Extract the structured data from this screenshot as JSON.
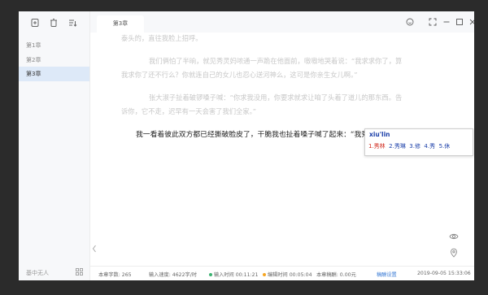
{
  "sidebar": {
    "chapters": [
      {
        "label": "第1章",
        "active": false
      },
      {
        "label": "第2章",
        "active": false
      },
      {
        "label": "第3章",
        "active": true
      }
    ],
    "bottom_label": "基中无人"
  },
  "tabs": [
    {
      "label": "第3章"
    }
  ],
  "editor": {
    "paragraphs": [
      "泰头的，直往我脸上招呼。",
      "我们俩怕了半晌，就见秀灵妈哝通一声跪在他面前，嗷嗷地哭着说：“我求求你了，算",
      "我求你了还不行么？你就连自己的女儿也忍心送河神么，这可是你亲生女儿啊。”",
      "张大淑子扯着破锣嗓子喊：“你求我没用，你要求就求让咱了头着了道儿的那东西。告",
      "诉你，它不走，迟早有一天会害了我们全家。”"
    ],
    "current_line": "我一看着彼此双方都已经撕破脸皮了，干脆我也扯着嗓子喊了起来：“我秀",
    "current_line_underlined": "秀"
  },
  "ime": {
    "pinyin": "xiu'lin",
    "candidates": [
      "1.秀林",
      "2.秀琳",
      "3.修",
      "4.秀",
      "5.休"
    ]
  },
  "status": {
    "chapter_words": "本章字数: 265",
    "input_speed": "输入速度: 4622字/时",
    "input_time": "输入时间 00:11:21",
    "edit_time": "编辑时间 00:05:04",
    "earnings": "本章稿酬: 0.00元",
    "settings_link": "稿酬设置",
    "datetime": "2019-09-05 15:33:06"
  },
  "colors": {
    "accent": "#3a7bd5",
    "active_chapter_bg": "#dde9f8",
    "green_dot": "#3cb371",
    "orange_dot": "#f5a623"
  }
}
